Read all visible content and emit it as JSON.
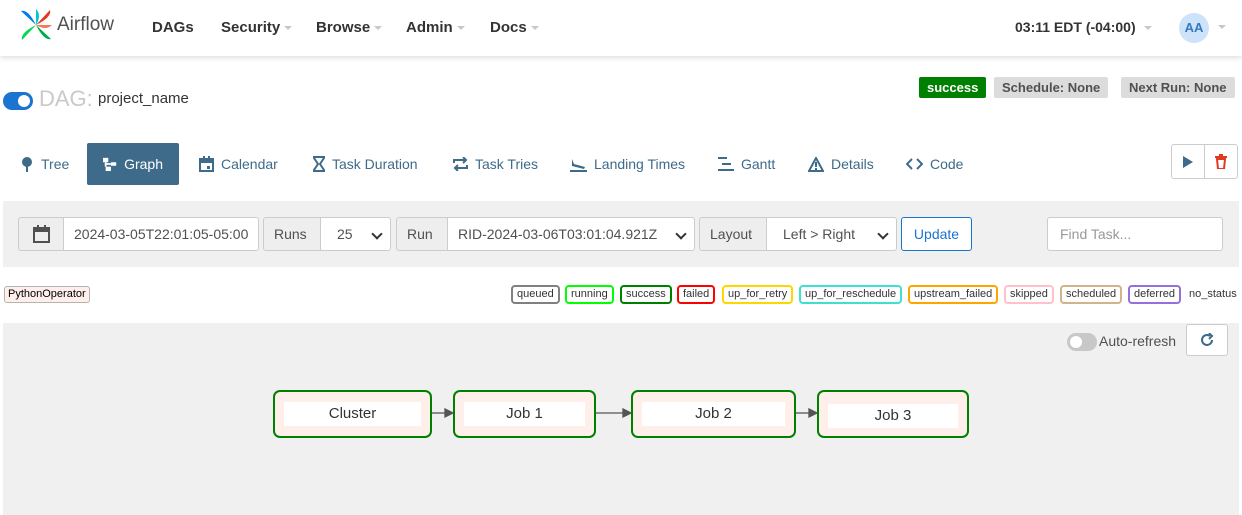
{
  "navbar": {
    "brand": "Airflow",
    "items": [
      {
        "label": "DAGs",
        "dropdown": false
      },
      {
        "label": "Security",
        "dropdown": true
      },
      {
        "label": "Browse",
        "dropdown": true
      },
      {
        "label": "Admin",
        "dropdown": true
      },
      {
        "label": "Docs",
        "dropdown": true
      }
    ],
    "time": "03:11 EDT (-04:00)",
    "user_initials": "AA"
  },
  "dag": {
    "prefix": "DAG:",
    "name": "project_name",
    "paused": false,
    "status": "success",
    "schedule": "Schedule: None",
    "next_run": "Next Run: None"
  },
  "tabs": [
    {
      "label": "Tree",
      "icon": "tree-icon"
    },
    {
      "label": "Graph",
      "icon": "graph-icon",
      "active": true
    },
    {
      "label": "Calendar",
      "icon": "calendar-icon"
    },
    {
      "label": "Task Duration",
      "icon": "hourglass-icon"
    },
    {
      "label": "Task Tries",
      "icon": "repeat-icon"
    },
    {
      "label": "Landing Times",
      "icon": "plane-landing-icon"
    },
    {
      "label": "Gantt",
      "icon": "gantt-icon"
    },
    {
      "label": "Details",
      "icon": "warning-icon"
    },
    {
      "label": "Code",
      "icon": "code-icon"
    }
  ],
  "actions": {
    "trigger_icon": "play-icon",
    "delete_icon": "trash-icon"
  },
  "controls": {
    "date_icon": "calendar-icon",
    "base_date": "2024-03-05T22:01:05-05:00",
    "runs_label": "Runs",
    "runs_value": "25",
    "run_label": "Run",
    "run_value": "RID-2024-03-06T03:01:04.921Z",
    "layout_label": "Layout",
    "layout_value": "Left > Right",
    "update_label": "Update",
    "find_placeholder": "Find Task..."
  },
  "legend": {
    "operator": "PythonOperator",
    "states": [
      {
        "label": "queued",
        "color": "#808080"
      },
      {
        "label": "running",
        "color": "#00ff00"
      },
      {
        "label": "success",
        "color": "#008000"
      },
      {
        "label": "failed",
        "color": "#ff0000"
      },
      {
        "label": "up_for_retry",
        "color": "#ffd700"
      },
      {
        "label": "up_for_reschedule",
        "color": "#40e0d0"
      },
      {
        "label": "upstream_failed",
        "color": "#ffa500"
      },
      {
        "label": "skipped",
        "color": "#ffc0cb"
      },
      {
        "label": "scheduled",
        "color": "#d2b48c"
      },
      {
        "label": "deferred",
        "color": "#9370db"
      }
    ],
    "no_status": "no_status"
  },
  "graph": {
    "auto_refresh_label": "Auto-refresh",
    "auto_refresh_on": false,
    "refresh_icon": "refresh-icon",
    "nodes": [
      {
        "label": "Cluster",
        "state": "success"
      },
      {
        "label": "Job 1",
        "state": "success"
      },
      {
        "label": "Job 2",
        "state": "success"
      },
      {
        "label": "Job 3",
        "state": "success"
      }
    ]
  }
}
